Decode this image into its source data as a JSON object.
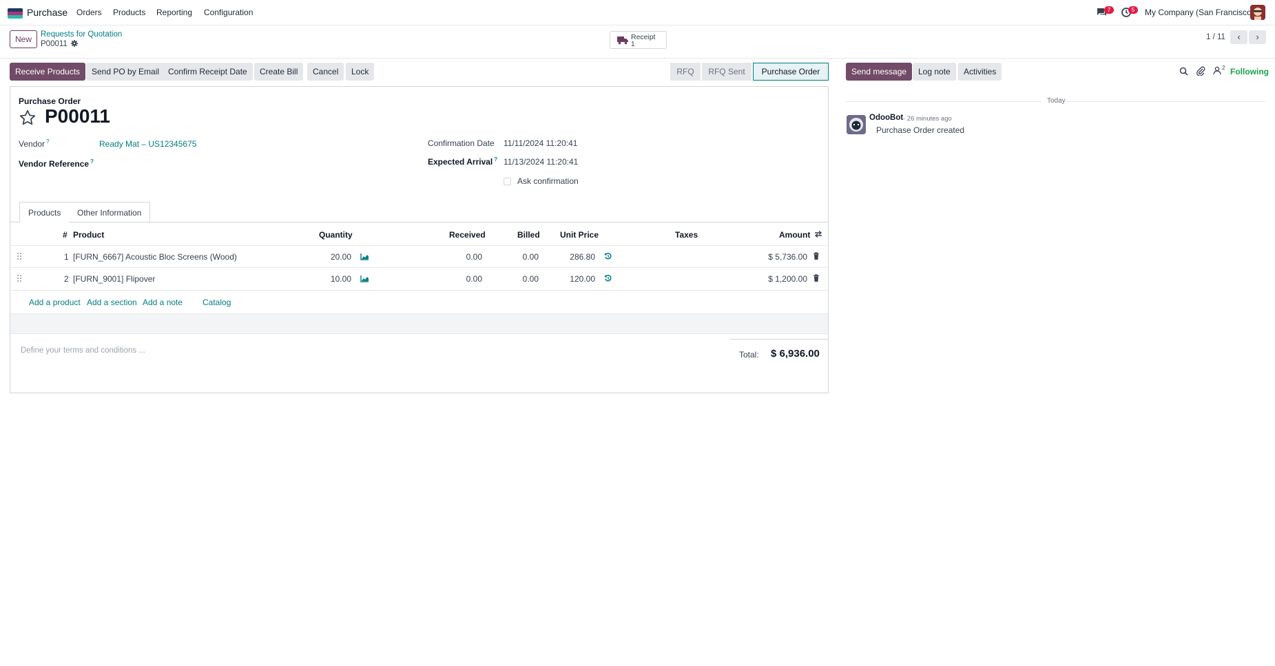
{
  "topnav": {
    "app_name": "Purchase",
    "menu": [
      "Orders",
      "Products",
      "Reporting",
      "Configuration"
    ],
    "messages_count": "7",
    "activities_count": "5",
    "company": "My Company (San Francisco)"
  },
  "control": {
    "new_label": "New",
    "breadcrumb_parent": "Requests for Quotation",
    "breadcrumb_current": "P00011",
    "smart_receipt_label": "Receipt",
    "smart_receipt_count": "1",
    "pager": "1 / 11"
  },
  "actions": {
    "receive": "Receive Products",
    "send_po": "Send PO by Email",
    "confirm_receipt": "Confirm Receipt Date",
    "create_bill": "Create Bill",
    "cancel": "Cancel",
    "lock": "Lock"
  },
  "status": {
    "stages": [
      "RFQ",
      "RFQ Sent",
      "Purchase Order"
    ],
    "active": "Purchase Order"
  },
  "form": {
    "doc_type": "Purchase Order",
    "name": "P00011",
    "vendor_label": "Vendor",
    "vendor_value": "Ready Mat – US12345675",
    "vendor_ref_label": "Vendor Reference",
    "confirmation_date_label": "Confirmation Date",
    "confirmation_date_value": "11/11/2024 11:20:41",
    "expected_arrival_label": "Expected Arrival",
    "expected_arrival_value": "11/13/2024 11:20:41",
    "ask_confirmation_label": "Ask confirmation",
    "ask_confirmation_checked": false,
    "qmark": "?"
  },
  "tabs": [
    "Products",
    "Other Information"
  ],
  "lines": {
    "headers": {
      "num": "#",
      "product": "Product",
      "quantity": "Quantity",
      "received": "Received",
      "billed": "Billed",
      "unit_price": "Unit Price",
      "taxes": "Taxes",
      "amount": "Amount"
    },
    "rows": [
      {
        "num": "1",
        "product": "[FURN_6667] Acoustic Bloc Screens (Wood)",
        "quantity": "20.00",
        "received": "0.00",
        "billed": "0.00",
        "unit_price": "286.80",
        "taxes": "",
        "amount": "$ 5,736.00"
      },
      {
        "num": "2",
        "product": "[FURN_9001] Flipover",
        "quantity": "10.00",
        "received": "0.00",
        "billed": "0.00",
        "unit_price": "120.00",
        "taxes": "",
        "amount": "$ 1,200.00"
      }
    ],
    "add_product": "Add a product",
    "add_section": "Add a section",
    "add_note": "Add a note",
    "catalog": "Catalog"
  },
  "footer": {
    "terms_placeholder": "Define your terms and conditions ...",
    "total_label": "Total:",
    "total_value": "$ 6,936.00"
  },
  "chatter": {
    "send_message": "Send message",
    "log_note": "Log note",
    "activities": "Activities",
    "followers_count": "2",
    "following": "Following",
    "day_label": "Today",
    "message_author": "OdooBot",
    "message_time": "- 26 minutes ago",
    "message_body": "Purchase Order created"
  },
  "colors": {
    "brand": "#714b67",
    "link": "#017e84",
    "badge": "#e11d48",
    "following": "#16a34a"
  }
}
